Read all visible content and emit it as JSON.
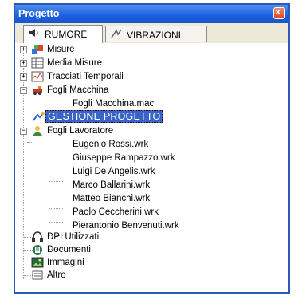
{
  "window": {
    "title": "Progetto",
    "close_glyph": "×"
  },
  "tabs": [
    {
      "label": "RUMORE",
      "icon": "speaker-icon"
    },
    {
      "label": "VIBRAZIONI",
      "icon": "vibration-icon"
    }
  ],
  "tree": {
    "misure": "Misure",
    "media_misure": "Media Misure",
    "tracciati": "Tracciati Temporali",
    "fogli_macchina": "Fogli Macchina",
    "fogli_macchina_file": "Fogli Macchina.mac",
    "gestione": "GESTIONE PROGETTO",
    "fogli_lavoratore": "Fogli Lavoratore",
    "workers": [
      "Eugenio Rossi.wrk",
      "Giuseppe Rampazzo.wrk",
      "Luigi De Angelis.wrk",
      "Marco Ballarini.wrk",
      "Matteo Bianchi.wrk",
      "Paolo Ceccherini.wrk",
      "Pierantonio Benvenuti.wrk"
    ],
    "dpi": "DPI Utilizzati",
    "documenti": "Documenti",
    "immagini": "Immagini",
    "altro": "Altro",
    "expand_plus": "+",
    "expand_minus": "−"
  }
}
